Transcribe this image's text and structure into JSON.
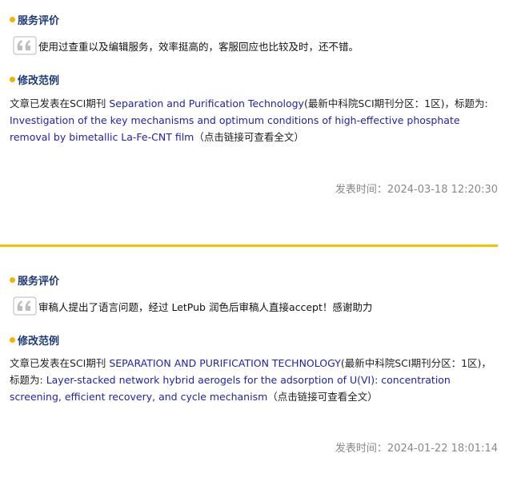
{
  "entries": [
    {
      "review_heading": "服务评价",
      "review_text": "使用过查重以及编辑服务，效率挺高的，客服回应也比较及时，还不错。",
      "example_heading": "修改范例",
      "example_prefix": "文章已发表在SCI期刊 ",
      "journal": "Separation and Purification Technology",
      "example_mid": "(最新中科院SCI期刊分区：1区)，标题为: ",
      "title": "Investigation of the key mechanisms and optimum conditions of high-effective phosphate removal by bimetallic La-Fe-CNT film",
      "example_suffix": "（点击链接可查看全文）",
      "time": "发表时间：2024-03-18 12:20:30"
    },
    {
      "review_heading": "服务评价",
      "review_text": "审稿人提出了语言问题，经过 LetPub 润色后审稿人直接accept！感谢助力",
      "example_heading": "修改范例",
      "example_prefix": "文章已发表在SCI期刊 ",
      "journal": "SEPARATION AND PURIFICATION TECHNOLOGY",
      "example_mid": "(最新中科院SCI期刊分区：1区)，标题为: ",
      "title": "Layer-stacked network hybrid aerogels for the adsorption of U(VI): concentration screening, efficient recovery, and cycle mechanism",
      "example_suffix": "（点击链接可查看全文）",
      "time": "发表时间：2024-01-22 18:01:14"
    }
  ],
  "colors": {
    "accent": "#f2b400",
    "heading": "#1c3a7a",
    "link": "#2222aa",
    "muted": "#888888",
    "separator": "#f2c400"
  },
  "icons": {
    "quote": "quote-icon"
  }
}
